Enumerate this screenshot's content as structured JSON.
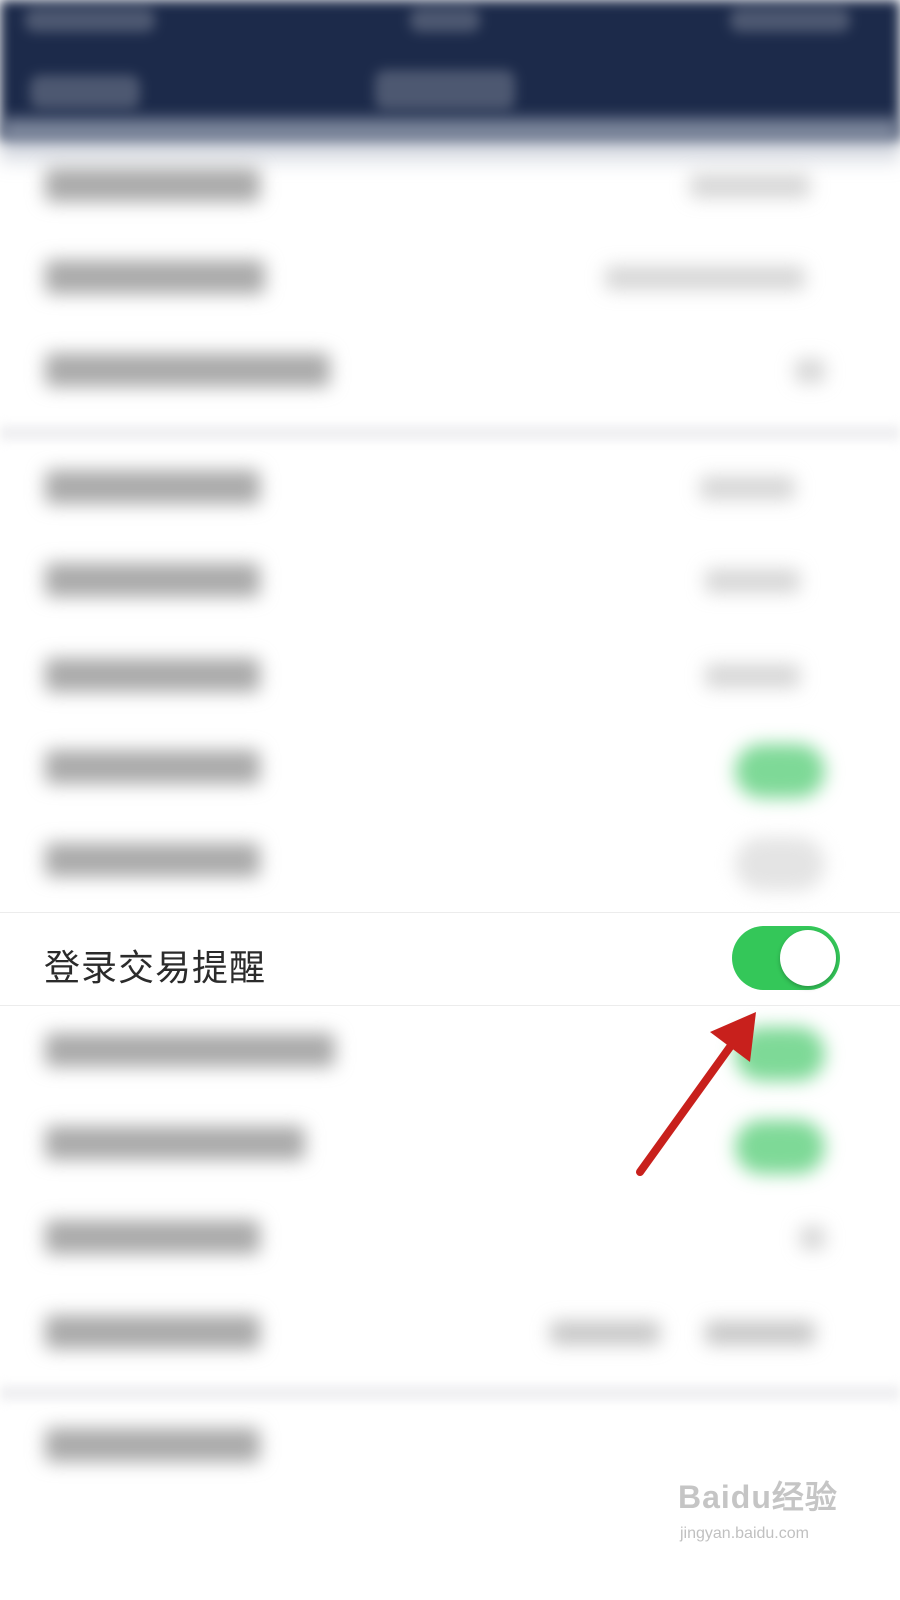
{
  "setting_row": {
    "label": "登录交易提醒",
    "toggle_on": true
  },
  "colors": {
    "toggle_on": "#34c759",
    "navbar": "#1c2a4a",
    "arrow": "#c8201c"
  },
  "watermark": {
    "logo": "Baidu经验",
    "url": "jingyan.baidu.com"
  }
}
